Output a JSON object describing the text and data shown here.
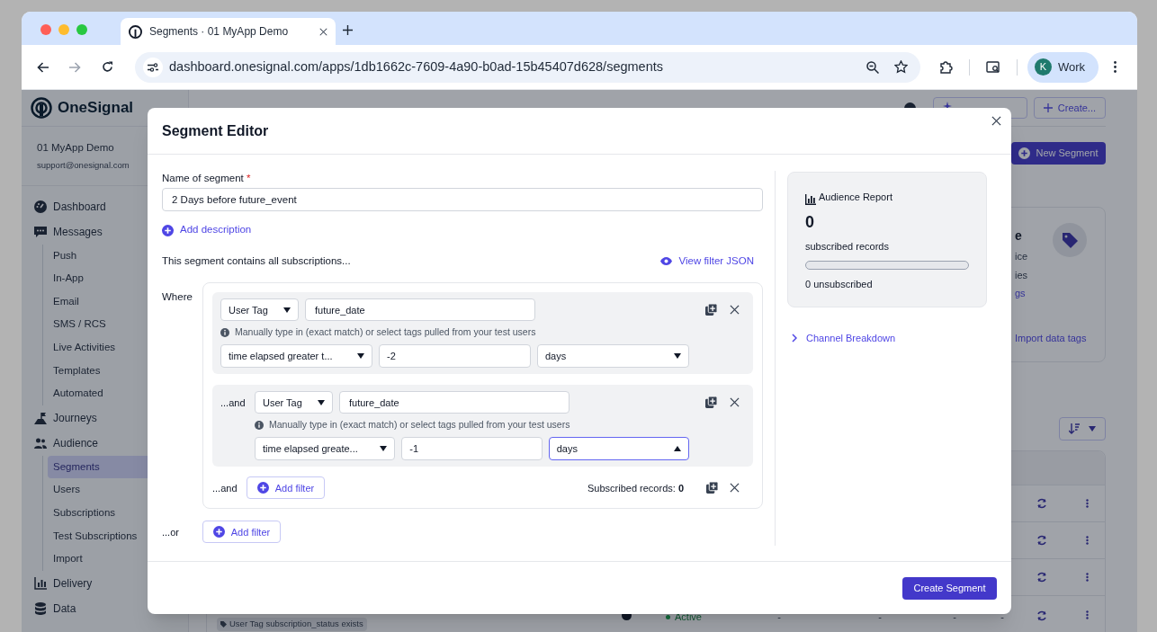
{
  "browser": {
    "tab_title": "Segments · 01 MyApp Demo",
    "url": "dashboard.onesignal.com/apps/1db1662c-7609-4a90-b0ad-15b45407d628/segments",
    "profile_initial": "K",
    "profile_name": "Work"
  },
  "sidebar": {
    "brand": "OneSignal",
    "app_name": "01 MyApp Demo",
    "email": "support@onesignal.com",
    "items": [
      {
        "label": "Dashboard",
        "selected": false
      },
      {
        "label": "Messages",
        "selected": false,
        "children": [
          {
            "label": "Push",
            "selected": false
          },
          {
            "label": "In-App",
            "selected": false
          },
          {
            "label": "Email",
            "selected": false
          },
          {
            "label": "SMS / RCS",
            "selected": false
          },
          {
            "label": "Live Activities",
            "selected": false
          },
          {
            "label": "Templates",
            "selected": false
          },
          {
            "label": "Automated",
            "selected": false
          }
        ]
      },
      {
        "label": "Journeys",
        "selected": false
      },
      {
        "label": "Audience",
        "selected": false,
        "children": [
          {
            "label": "Segments",
            "selected": true
          },
          {
            "label": "Users",
            "selected": false
          },
          {
            "label": "Subscriptions",
            "selected": false
          },
          {
            "label": "Test Subscriptions",
            "selected": false
          },
          {
            "label": "Import",
            "selected": false
          }
        ]
      },
      {
        "label": "Delivery",
        "selected": false
      },
      {
        "label": "Data",
        "selected": false
      }
    ]
  },
  "page": {
    "header_buttons": [
      "Create..."
    ],
    "new_segment_button": "New Segment",
    "card_heading": "e",
    "card_lines": [
      "ice",
      "ies"
    ],
    "card_link": "gs",
    "import_link": "Import data tags",
    "table_rows": [
      {
        "kind": "covered"
      },
      {
        "kind": "covered"
      },
      {
        "kind": "covered"
      },
      {
        "kind": "full",
        "tag": "User Tag subscription_status exists",
        "status": "Active",
        "cells": [
          "-",
          "-",
          "-",
          "-"
        ]
      }
    ]
  },
  "modal": {
    "title": "Segment Editor",
    "name_label": "Name of segment",
    "required_mark": "*",
    "name_value": "2 Days before future_event",
    "add_description": "Add description",
    "contains_text": "This segment contains all subscriptions...",
    "view_json": "View filter JSON",
    "where_label": "Where",
    "filter_group": {
      "filters": [
        {
          "field": "User Tag",
          "key": "future_date",
          "hint": "Manually type in (exact match) or select tags pulled from your test users",
          "operator": "time elapsed greater t...",
          "value": "-2",
          "unit": "days",
          "unit_open": false
        },
        {
          "connector": "...and",
          "field": "User Tag",
          "key": "future_date",
          "hint": "Manually type in (exact match) or select tags pulled from your test users",
          "operator": "time elapsed greate...",
          "value": "-1",
          "unit": "days",
          "unit_open": true
        }
      ],
      "add_connector": "...and",
      "add_filter": "Add filter",
      "records": "Subscribed records: **0**"
    },
    "or_label": "...or",
    "or_add_filter": "Add filter",
    "report": {
      "title": "Audience Report",
      "count": "0",
      "count_label": "subscribed records",
      "level": 0,
      "unsubscribed": "0 unsubscribed"
    },
    "channel_breakdown": {
      "label": "Channel Breakdown",
      "expanded": false
    },
    "create_button": "Create Segment"
  }
}
